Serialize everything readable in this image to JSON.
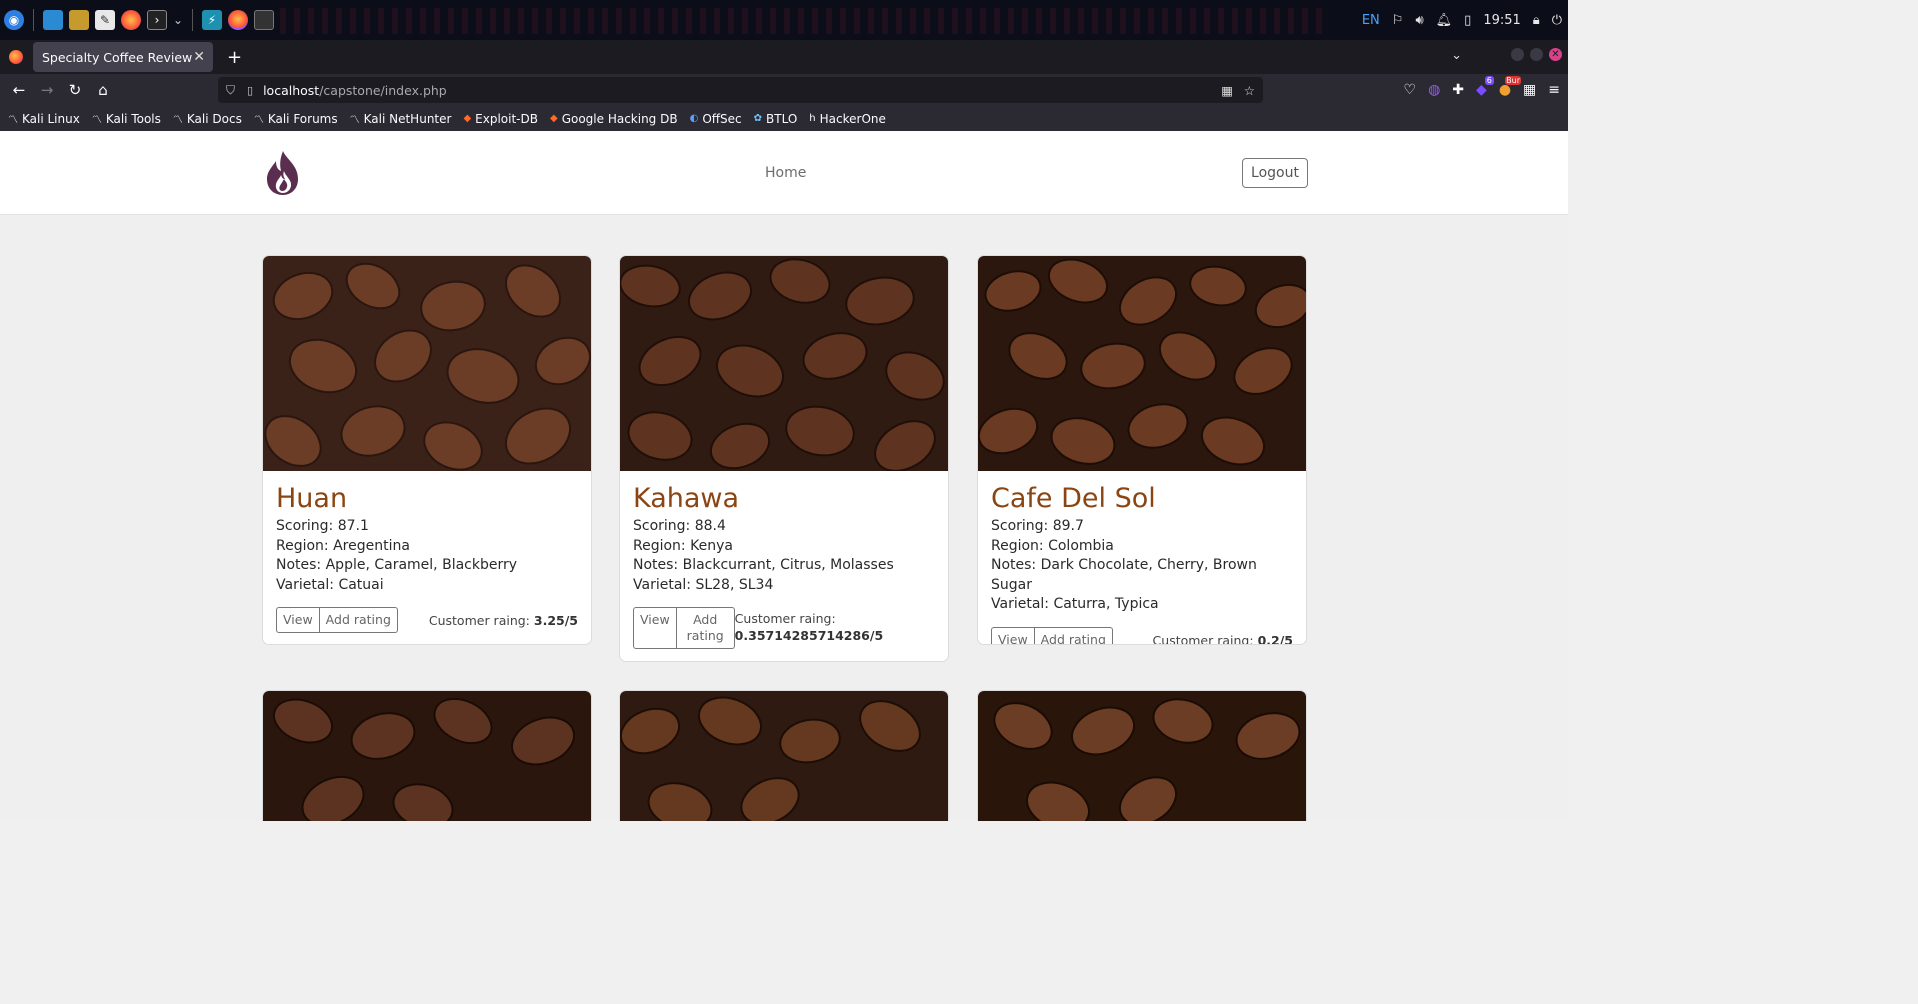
{
  "taskbar": {
    "language": "EN",
    "clock": "19:51"
  },
  "browser": {
    "tab_title": "Specialty Coffee Review",
    "url_host": "localhost",
    "url_path": "/capstone/index.php",
    "badge_ext1": "6",
    "badge_ext2": "Bur",
    "bookmarks": [
      {
        "label": "Kali Linux",
        "icon": "kali-dragon-icon"
      },
      {
        "label": "Kali Tools",
        "icon": "kali-dragon-icon"
      },
      {
        "label": "Kali Docs",
        "icon": "kali-dragon-icon"
      },
      {
        "label": "Kali Forums",
        "icon": "kali-dragon-icon"
      },
      {
        "label": "Kali NetHunter",
        "icon": "kali-dragon-icon"
      },
      {
        "label": "Exploit-DB",
        "icon": "exploitdb-icon"
      },
      {
        "label": "Google Hacking DB",
        "icon": "exploitdb-icon"
      },
      {
        "label": "OffSec",
        "icon": "offsec-icon"
      },
      {
        "label": "BTLO",
        "icon": "btlo-icon"
      },
      {
        "label": "HackerOne",
        "icon": "hackerone-icon"
      }
    ]
  },
  "site": {
    "nav_home": "Home",
    "logout_label": "Logout",
    "view_label": "View",
    "add_rating_label": "Add rating",
    "rating_prefix": "Customer raing:",
    "accent_color": "#8b4513"
  },
  "coffees": [
    {
      "name": "Huan",
      "scoring": "Scoring: 87.1",
      "region": "Region: Aregentina",
      "notes": "Notes: Apple, Caramel, Blackberry",
      "varietal": "Varietal: Catuai",
      "rating": "3.25/5"
    },
    {
      "name": "Kahawa",
      "scoring": "Scoring: 88.4",
      "region": "Region: Kenya",
      "notes": "Notes: Blackcurrant, Citrus, Molasses",
      "varietal": "Varietal: SL28, SL34",
      "rating": "0.35714285714286/5"
    },
    {
      "name": "Cafe Del Sol",
      "scoring": "Scoring: 89.7",
      "region": "Region: Colombia",
      "notes": "Notes: Dark Chocolate, Cherry, Brown Sugar",
      "varietal": "Varietal: Caturra, Typica",
      "rating": "0.2/5"
    }
  ]
}
